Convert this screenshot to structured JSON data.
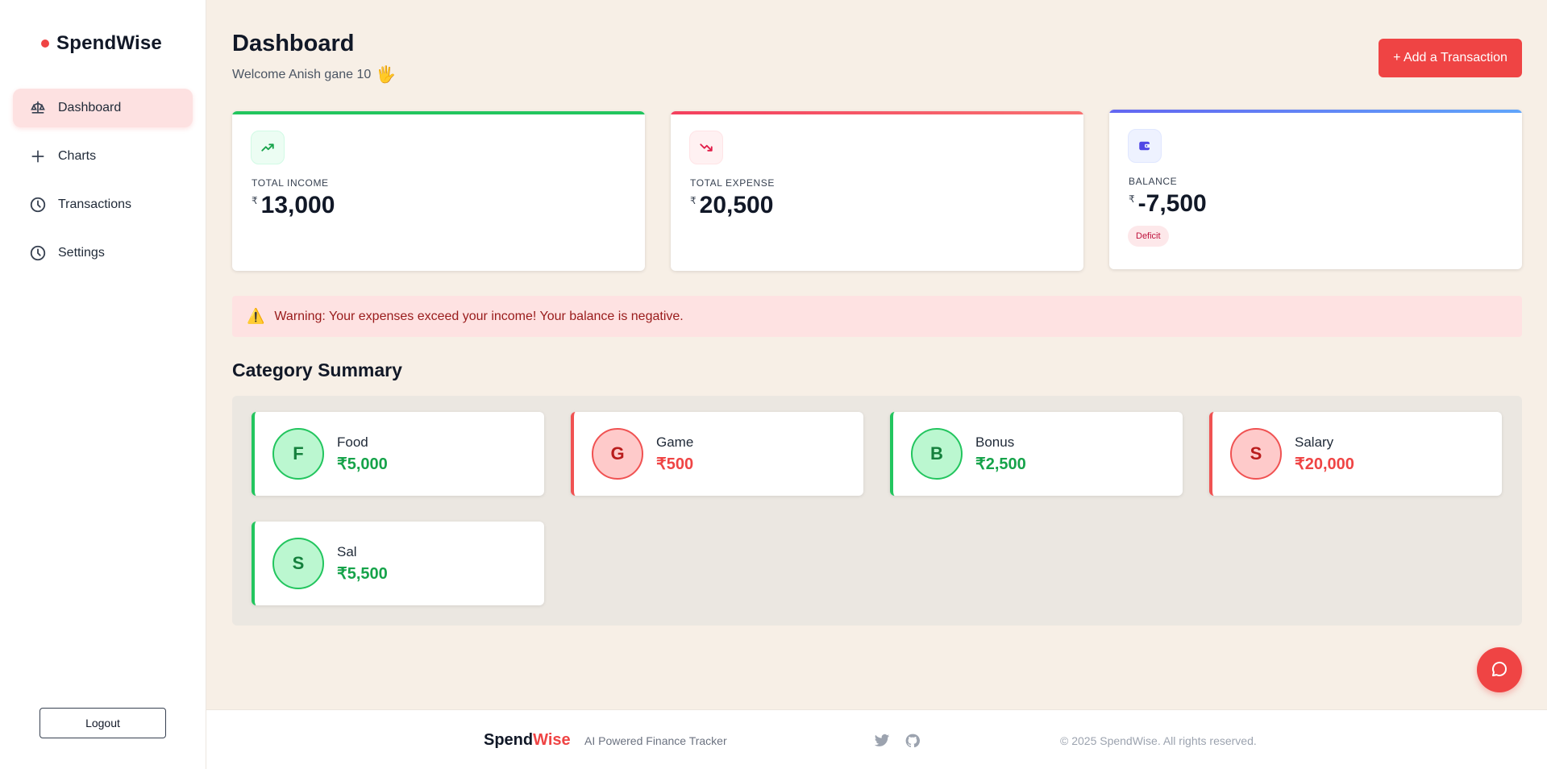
{
  "brand": {
    "name": "SpendWise",
    "accent_color": "#ef4444"
  },
  "sidebar": {
    "items": [
      {
        "label": "Dashboard",
        "icon": "scale-icon",
        "active": true
      },
      {
        "label": "Charts",
        "icon": "plus-icon",
        "active": false
      },
      {
        "label": "Transactions",
        "icon": "clock-icon",
        "active": false
      },
      {
        "label": "Settings",
        "icon": "clock-icon",
        "active": false
      }
    ],
    "logout_label": "Logout"
  },
  "header": {
    "title": "Dashboard",
    "welcome": "Welcome Anish gane 10",
    "wave_emoji": "🖐",
    "add_button": "+ Add a Transaction"
  },
  "stats": {
    "income": {
      "label": "TOTAL INCOME",
      "currency": "₹",
      "amount": "13,000",
      "color": "#22c55e",
      "icon": "trending-up-icon"
    },
    "expense": {
      "label": "TOTAL EXPENSE",
      "currency": "₹",
      "amount": "20,500",
      "color": "#f43f5e",
      "icon": "trending-down-icon"
    },
    "balance": {
      "label": "BALANCE",
      "currency": "₹",
      "amount": "-7,500",
      "badge": "Deficit",
      "color": "#6366f1",
      "icon": "wallet-icon"
    }
  },
  "warning": {
    "icon": "⚠️",
    "text": "Warning: Your expenses exceed your income! Your balance is negative."
  },
  "category_summary": {
    "title": "Category Summary",
    "items": [
      {
        "initial": "F",
        "name": "Food",
        "amount": "₹5,000",
        "type": "income"
      },
      {
        "initial": "G",
        "name": "Game",
        "amount": "₹500",
        "type": "expense"
      },
      {
        "initial": "B",
        "name": "Bonus",
        "amount": "₹2,500",
        "type": "income"
      },
      {
        "initial": "S",
        "name": "Salary",
        "amount": "₹20,000",
        "type": "expense"
      },
      {
        "initial": "S",
        "name": "Sal",
        "amount": "₹5,500",
        "type": "income"
      }
    ]
  },
  "footer": {
    "brand_main": "Spend",
    "brand_accent": "Wise",
    "tagline": "AI Powered Finance Tracker",
    "social": [
      "twitter-icon",
      "github-icon"
    ],
    "copyright": "© 2025 SpendWise. All rights reserved."
  }
}
